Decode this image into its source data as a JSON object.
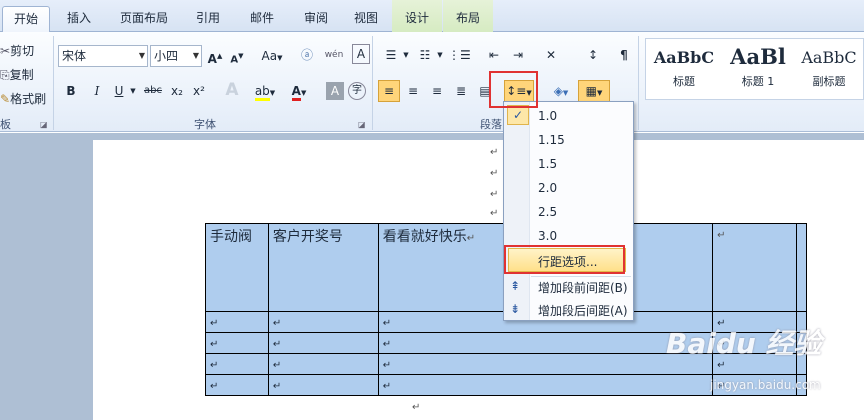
{
  "tabs": [
    "开始",
    "插入",
    "页面布局",
    "引用",
    "邮件",
    "审阅",
    "视图",
    "设计",
    "布局"
  ],
  "clipboard": {
    "cut": "剪切",
    "copy": "复制",
    "format_painter": "格式刷",
    "group": "板"
  },
  "font": {
    "name": "宋体",
    "size": "小四",
    "group": "字体",
    "bold": "B",
    "italic": "I",
    "underline": "U",
    "strike": "abc",
    "sub": "x₂",
    "sup": "x²",
    "grow": "A",
    "shrink": "A",
    "change_case": "Aa",
    "font_color": "A",
    "char_shading": "A",
    "enclose": "字"
  },
  "paragraph": {
    "group": "段落"
  },
  "styles": [
    {
      "preview": "AaBbC",
      "name": "标题"
    },
    {
      "preview": "AaBl",
      "name": "标题 1"
    },
    {
      "preview": "AaBbC",
      "name": "副标题"
    }
  ],
  "line_spacing_menu": {
    "items": [
      "1.0",
      "1.15",
      "1.5",
      "2.0",
      "2.5",
      "3.0"
    ],
    "checked": "1.0",
    "options": "行距选项...",
    "add_before": "增加段前间距(B)",
    "add_after": "增加段后间距(A)"
  },
  "table": {
    "headers": [
      "手动阀",
      "客户开奖号",
      "看看就好快乐"
    ],
    "para_mark": "↵"
  },
  "watermark": {
    "brand": "Baidu 经验",
    "url": "jingyan.baidu.com"
  }
}
